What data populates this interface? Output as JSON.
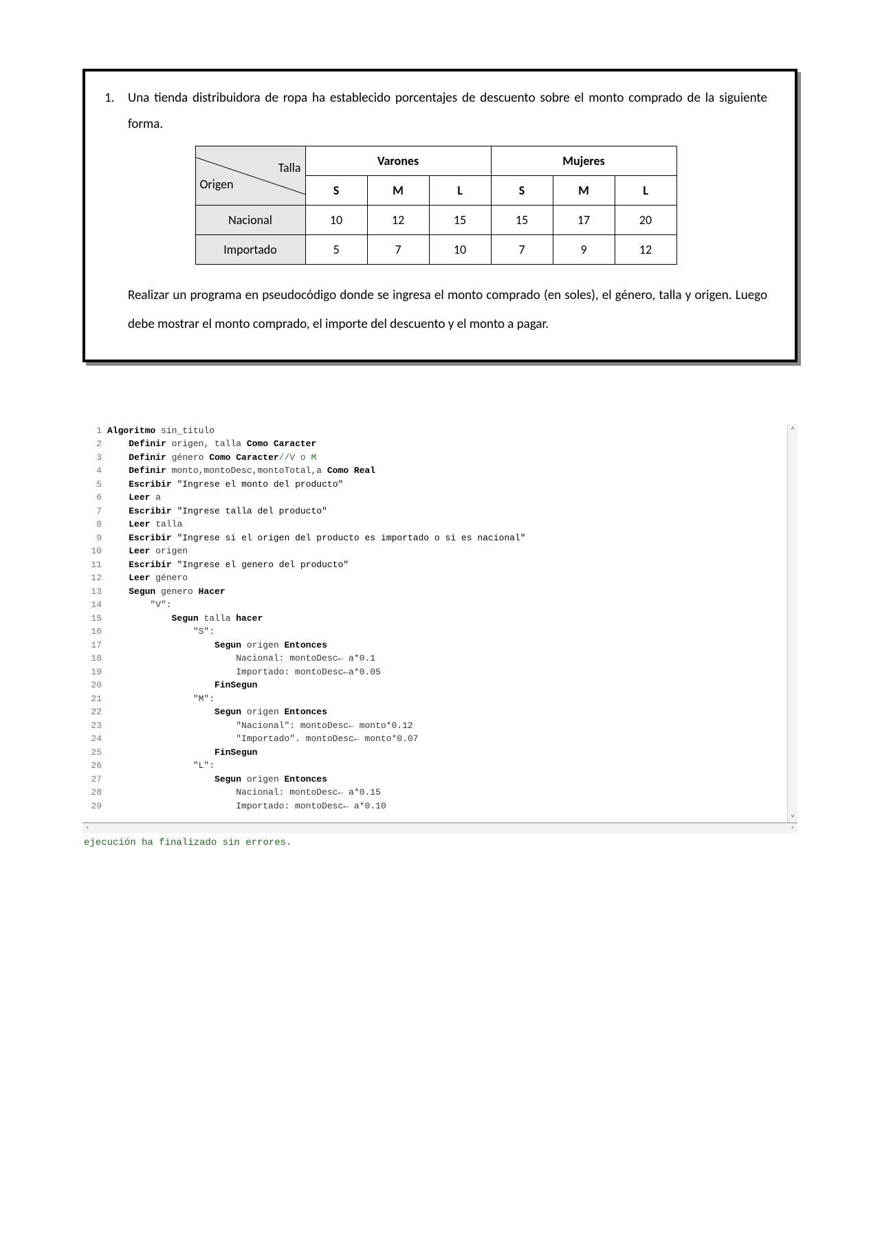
{
  "exercise": {
    "number": "1.",
    "prompt": "Una tienda distribuidora de ropa ha establecido porcentajes de descuento sobre el monto comprado de la siguiente forma.",
    "post": "Realizar un programa en pseudocódigo donde se ingresa el monto comprado (en soles), el género, talla y origen. Luego debe mostrar el monto comprado, el importe del descuento y el monto a pagar."
  },
  "table": {
    "corner_top": "Talla",
    "corner_bottom": "Origen",
    "group_headers": [
      "Varones",
      "Mujeres"
    ],
    "sizes": [
      "S",
      "M",
      "L",
      "S",
      "M",
      "L"
    ],
    "rows": [
      {
        "label": "Nacional",
        "vals": [
          "10",
          "12",
          "15",
          "15",
          "17",
          "20"
        ]
      },
      {
        "label": "Importado",
        "vals": [
          "5",
          "7",
          "10",
          "7",
          "9",
          "12"
        ]
      }
    ]
  },
  "code": {
    "lines": [
      {
        "n": "1",
        "html": "<span class='kw'>Algoritmo</span> sin_titulo"
      },
      {
        "n": "2",
        "html": "    <span class='kw'>Definir</span> origen, talla <span class='kw'>Como Caracter</span>"
      },
      {
        "n": "3",
        "html": "    <span class='kw'>Definir</span> género <span class='kw'>Como Caracter</span><span class='cmt'>//V o M</span>"
      },
      {
        "n": "4",
        "html": "    <span class='kw'>Definir</span> monto,montoDesc,montoTotal,a <span class='kw'>Como Real</span>"
      },
      {
        "n": "5",
        "html": "    <span class='kw'>Escribir</span> <span class='str'>\"Ingrese el monto del producto\"</span>"
      },
      {
        "n": "6",
        "html": "    <span class='kw'>Leer</span> a"
      },
      {
        "n": "7",
        "html": "    <span class='kw'>Escribir</span> <span class='str'>\"Ingrese talla del producto\"</span>"
      },
      {
        "n": "8",
        "html": "    <span class='kw'>Leer</span> talla"
      },
      {
        "n": "9",
        "html": "    <span class='kw'>Escribir</span> <span class='str'>\"Ingrese si el origen del producto es importado o si es nacional\"</span>"
      },
      {
        "n": "10",
        "html": "    <span class='kw'>Leer</span> origen"
      },
      {
        "n": "11",
        "html": "    <span class='kw'>Escribir</span> <span class='str'>\"Ingrese el genero del producto\"</span>"
      },
      {
        "n": "12",
        "html": "    <span class='kw'>Leer</span> género"
      },
      {
        "n": "13",
        "html": "    <span class='kw'>Segun</span> genero <span class='kw'>Hacer</span>"
      },
      {
        "n": "14",
        "html": "        \"V\":"
      },
      {
        "n": "15",
        "html": "            <span class='kw'>Segun</span> talla <span class='kw'>hacer</span>"
      },
      {
        "n": "16",
        "html": "                \"S\":"
      },
      {
        "n": "17",
        "html": "                    <span class='kw'>Segun</span> origen <span class='kw'>Entonces</span>"
      },
      {
        "n": "18",
        "html": "                        Nacional: montoDesc← a*0.1"
      },
      {
        "n": "19",
        "html": "                        Importado: montoDesc←a*0.05"
      },
      {
        "n": "20",
        "html": "                    <span class='kw'>FinSegun</span>"
      },
      {
        "n": "21",
        "html": "                \"M\":"
      },
      {
        "n": "22",
        "html": "                    <span class='kw'>Segun</span> origen <span class='kw'>Entonces</span>"
      },
      {
        "n": "23",
        "html": "                        \"Nacional\": montoDesc← monto*0.12"
      },
      {
        "n": "24",
        "html": "                        \"Importado\". montoDesc← monto*0.07"
      },
      {
        "n": "25",
        "html": "                    <span class='kw'>FinSegun</span>"
      },
      {
        "n": "26",
        "html": "                \"L\":"
      },
      {
        "n": "27",
        "html": "                    <span class='kw'>Segun</span> origen <span class='kw'>Entonces</span>"
      },
      {
        "n": "28",
        "html": "                        Nacional: montoDesc← a*0.15"
      },
      {
        "n": "29",
        "html": "                        Importado: montoDesc← a*0.10"
      }
    ]
  },
  "status": "ejecución ha finalizado sin errores.",
  "scroll": {
    "up": "˄",
    "down": "˅",
    "left": "‹",
    "right": "›"
  }
}
